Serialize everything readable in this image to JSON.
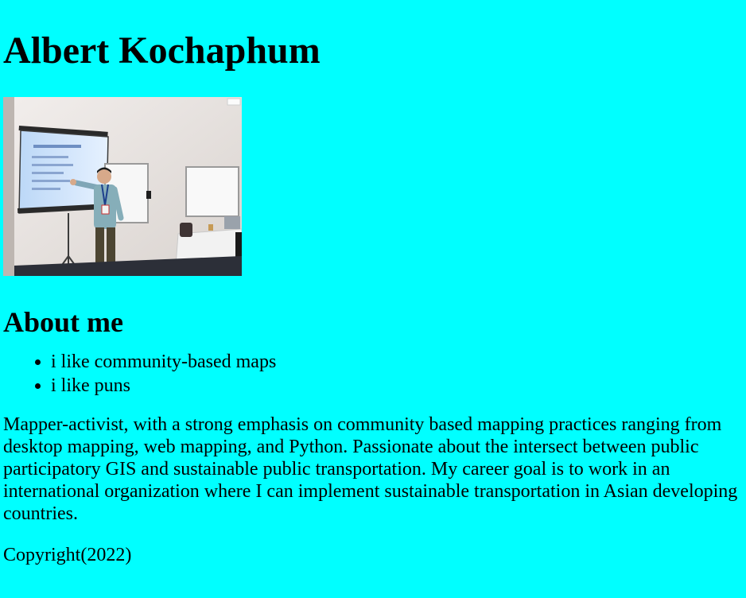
{
  "header": {
    "name": "Albert Kochaphum"
  },
  "photo": {
    "alt": "Albert presenting in front of a projector screen",
    "colors": {
      "wall": "#e7e3e1",
      "screen": "#cfe4ff",
      "floor": "#2c2f38"
    }
  },
  "about": {
    "heading": "About me",
    "items": [
      "i like community-based maps",
      "i like puns"
    ],
    "bio": "Mapper-activist, with a strong emphasis on community based mapping practices ranging from desktop mapping, web mapping, and Python. Passionate about the intersect between public participatory GIS and sustainable public transportation. My career goal is to work in an international organization where I can implement sustainable transportation in Asian developing countries."
  },
  "footer": {
    "copyright": "Copyright(2022)"
  },
  "theme": {
    "background": "#00ffff",
    "text": "#000000"
  }
}
